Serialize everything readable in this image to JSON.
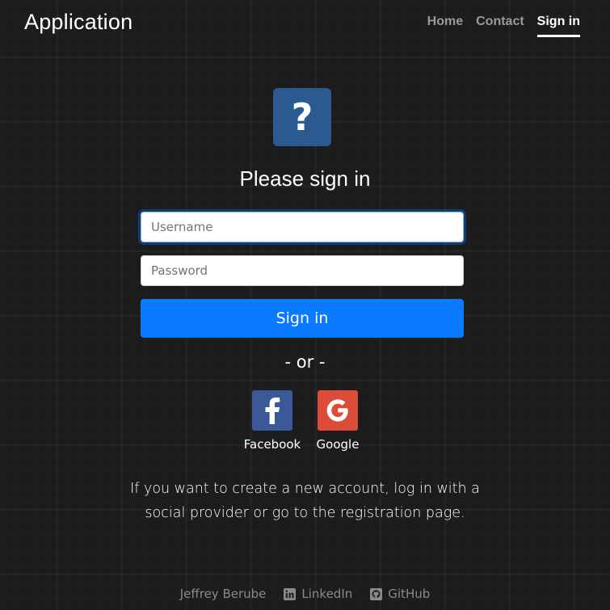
{
  "navbar": {
    "brand": "Application",
    "items": [
      {
        "label": "Home",
        "active": false
      },
      {
        "label": "Contact",
        "active": false
      },
      {
        "label": "Sign in",
        "active": true
      }
    ]
  },
  "logo": {
    "glyph": "?",
    "icon": "question-mark-icon",
    "color": "#2a5a8f"
  },
  "form": {
    "heading": "Please sign in",
    "username": {
      "placeholder": "Username",
      "value": ""
    },
    "password": {
      "placeholder": "Password",
      "value": ""
    },
    "submit_label": "Sign in",
    "submit_color": "#0a7bff"
  },
  "divider": "- or -",
  "social": [
    {
      "label": "Facebook",
      "icon": "facebook-icon",
      "color": "#3b5998"
    },
    {
      "label": "Google",
      "icon": "google-icon",
      "color": "#dd4b39"
    }
  ],
  "info_text": "If you want to create a new account, log in with a social provider or go to the registration page.",
  "footer": {
    "author": "Jeffrey Berube",
    "links": [
      {
        "label": "LinkedIn",
        "icon": "linkedin-icon"
      },
      {
        "label": "GitHub",
        "icon": "github-icon"
      }
    ]
  }
}
